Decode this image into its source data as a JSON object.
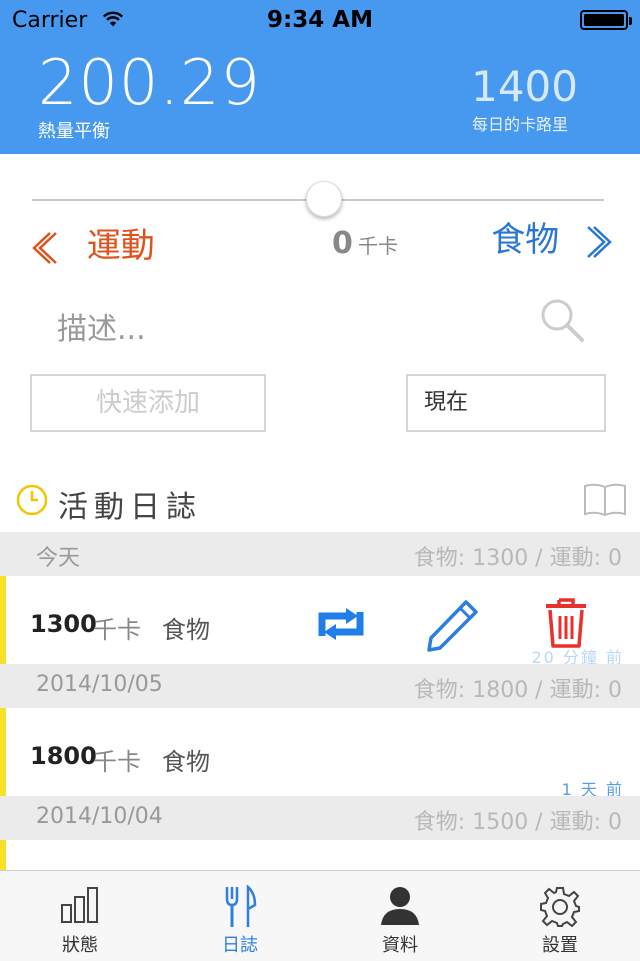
{
  "status": {
    "carrier": "Carrier",
    "time": "9:34 AM"
  },
  "header": {
    "balance": "200.29",
    "balance_label": "熱量平衡",
    "daily": "1400",
    "daily_label": "每日的卡路里"
  },
  "slider": {
    "left_label": "運動",
    "right_label": "食物",
    "value": "0",
    "unit": "千卡",
    "position_percent": 50
  },
  "search": {
    "placeholder": "描述..."
  },
  "buttons": {
    "quick_add": "快速添加",
    "now": "現在"
  },
  "log": {
    "title": "活動日誌"
  },
  "sections": [
    {
      "date": "今天",
      "summary": "食物: 1300 / 運動: 0"
    },
    {
      "date": "2014/10/05",
      "summary": "食物: 1800 / 運動: 0"
    },
    {
      "date": "2014/10/04",
      "summary": "食物: 1500 / 運動: 0"
    }
  ],
  "entries": [
    {
      "calories": "1300",
      "unit": "千卡",
      "type": "食物",
      "ago": "20 分鐘 前"
    },
    {
      "calories": "1800",
      "unit": "千卡",
      "type": "食物",
      "ago": "1 天 前"
    }
  ],
  "tabs": [
    {
      "label": "狀態",
      "icon": "bar-chart-icon"
    },
    {
      "label": "日誌",
      "icon": "fork-knife-icon",
      "active": true
    },
    {
      "label": "資料",
      "icon": "person-icon"
    },
    {
      "label": "設置",
      "icon": "gear-icon"
    }
  ],
  "colors": {
    "header": "#4799ef",
    "exercise": "#e0521c",
    "food": "#2977d5",
    "delete": "#e8312c",
    "accent_bar": "#f8e12a"
  }
}
